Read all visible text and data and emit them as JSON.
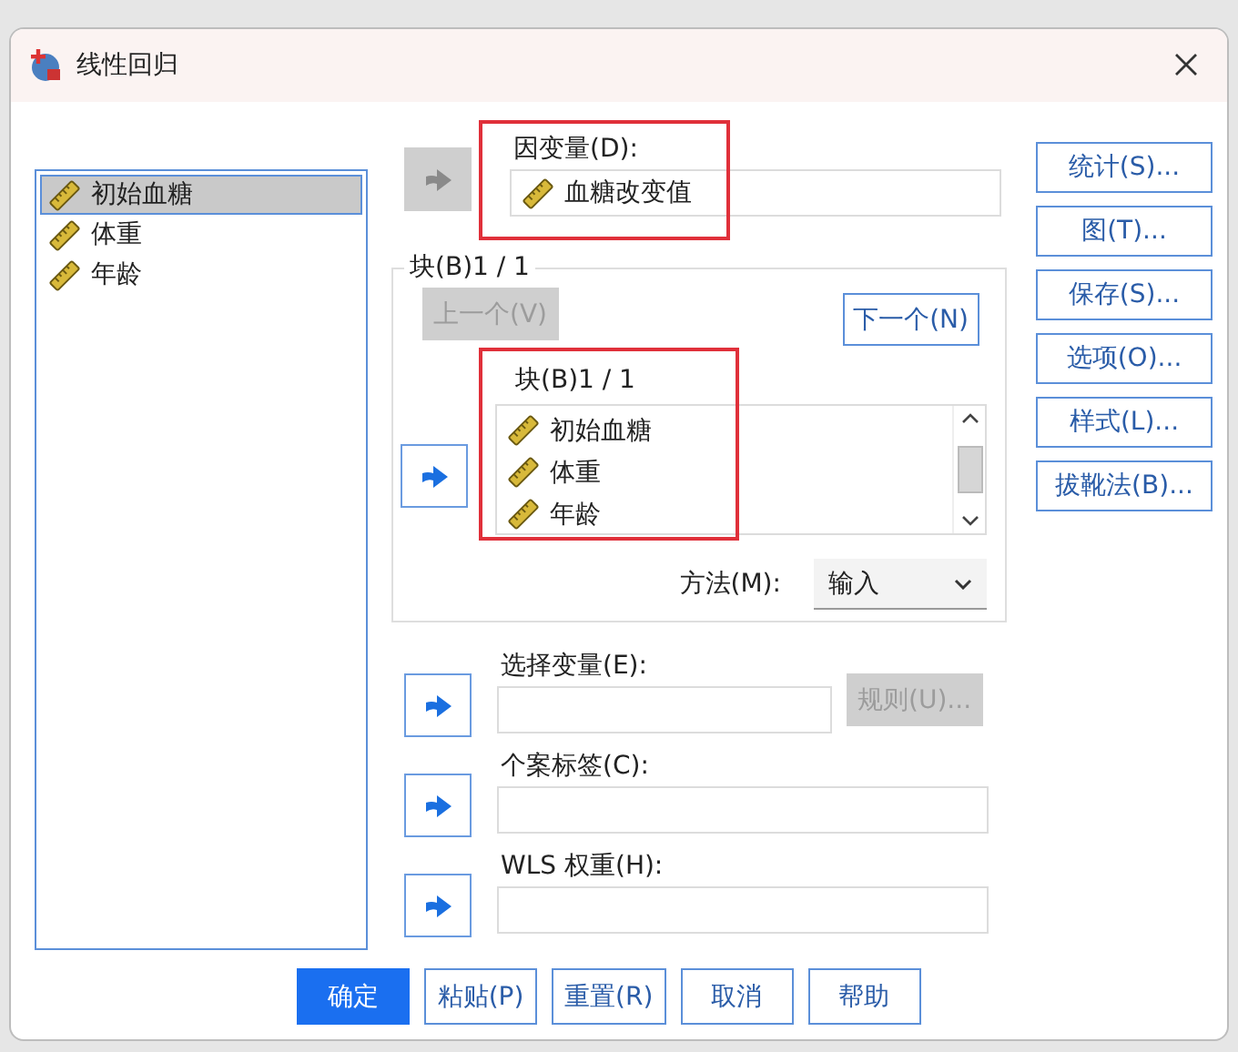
{
  "window": {
    "title": "线性回归"
  },
  "variables": [
    {
      "name": "初始血糖",
      "selected": true
    },
    {
      "name": "体重",
      "selected": false
    },
    {
      "name": "年龄",
      "selected": false
    }
  ],
  "dependent": {
    "label": "因变量(D):",
    "value": "血糖改变值",
    "highlighted": true,
    "arrow_disabled": true
  },
  "block": {
    "legend": "块(B)1 / 1",
    "previous": {
      "label": "上一个(V)",
      "disabled": true
    },
    "next": {
      "label": "下一个(N)",
      "disabled": false
    },
    "arrow_disabled": false,
    "independents": {
      "label": "块(B)1 / 1",
      "highlighted": true,
      "items": [
        "初始血糖",
        "体重",
        "年龄"
      ]
    },
    "method": {
      "label": "方法(M):",
      "value": "输入"
    }
  },
  "selection": {
    "label": "选择变量(E):",
    "arrow_disabled": false,
    "rule_button": {
      "label": "规则(U)...",
      "disabled": true
    }
  },
  "case_labels": {
    "label": "个案标签(C):",
    "arrow_disabled": false
  },
  "wls": {
    "label": "WLS 权重(H):",
    "arrow_disabled": false
  },
  "side_buttons": [
    "统计(S)...",
    "图(T)...",
    "保存(S)...",
    "选项(O)...",
    "样式(L)...",
    "拔靴法(B)..."
  ],
  "buttons": [
    {
      "label": "确定",
      "default": true
    },
    {
      "label": "粘贴(P)",
      "default": false
    },
    {
      "label": "重置(R)",
      "default": false
    },
    {
      "label": "取消",
      "default": false
    },
    {
      "label": "帮助",
      "default": false
    }
  ]
}
